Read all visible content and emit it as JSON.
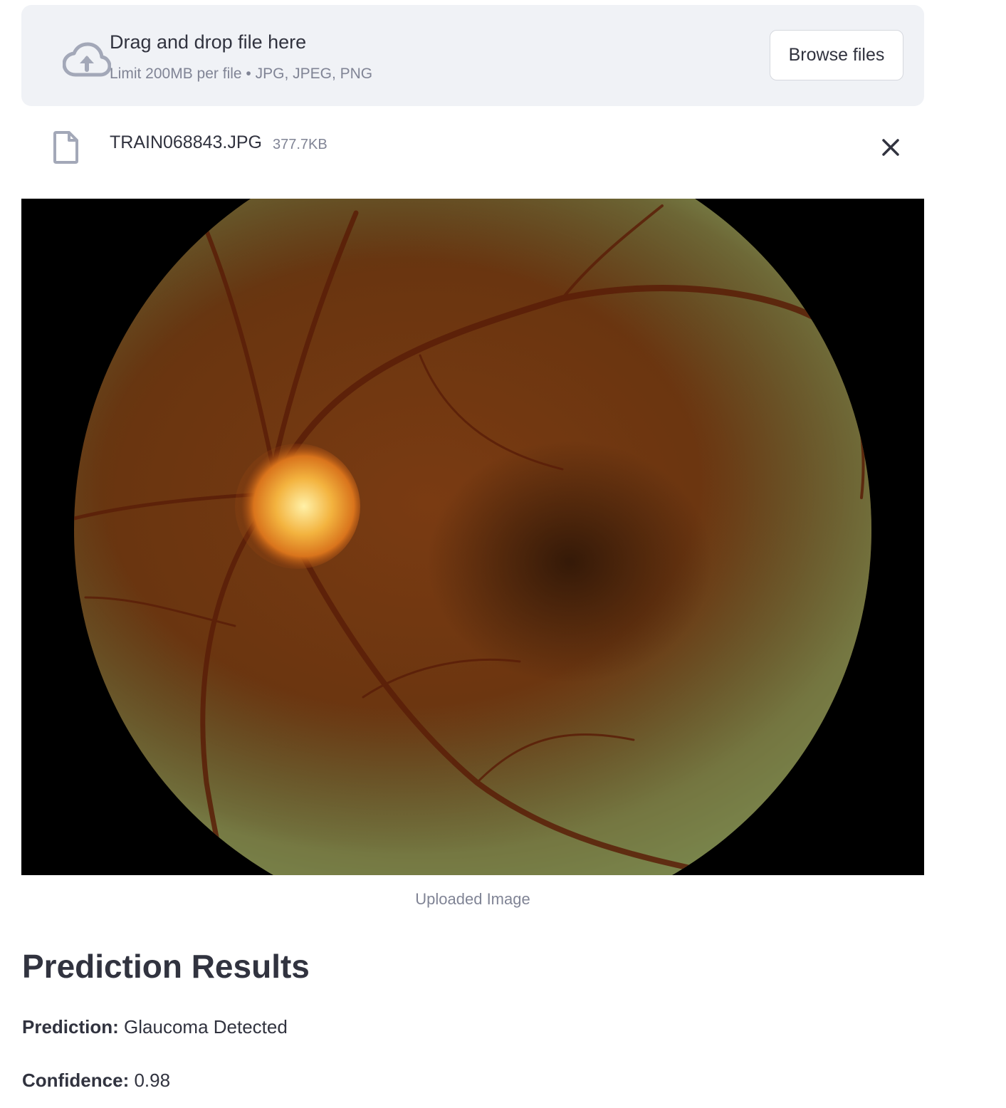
{
  "uploader": {
    "title": "Drag and drop file here",
    "subtitle": "Limit 200MB per file • JPG, JPEG, PNG",
    "browse_label": "Browse files",
    "upload_icon": "cloud-upload-icon"
  },
  "file": {
    "name": "TRAIN068843.JPG",
    "size": "377.7KB",
    "file_icon": "file-icon",
    "remove_icon": "close-icon"
  },
  "image": {
    "caption": "Uploaded Image",
    "description": "retinal fundus photograph"
  },
  "results": {
    "title": "Prediction Results",
    "prediction_label": "Prediction:",
    "prediction_value": "Glaucoma Detected",
    "confidence_label": "Confidence:",
    "confidence_value": "0.98"
  },
  "colors": {
    "dropzone_bg": "#f0f2f6",
    "text": "#31333f",
    "muted_text": "#808495",
    "icon": "#a3a8b8"
  }
}
